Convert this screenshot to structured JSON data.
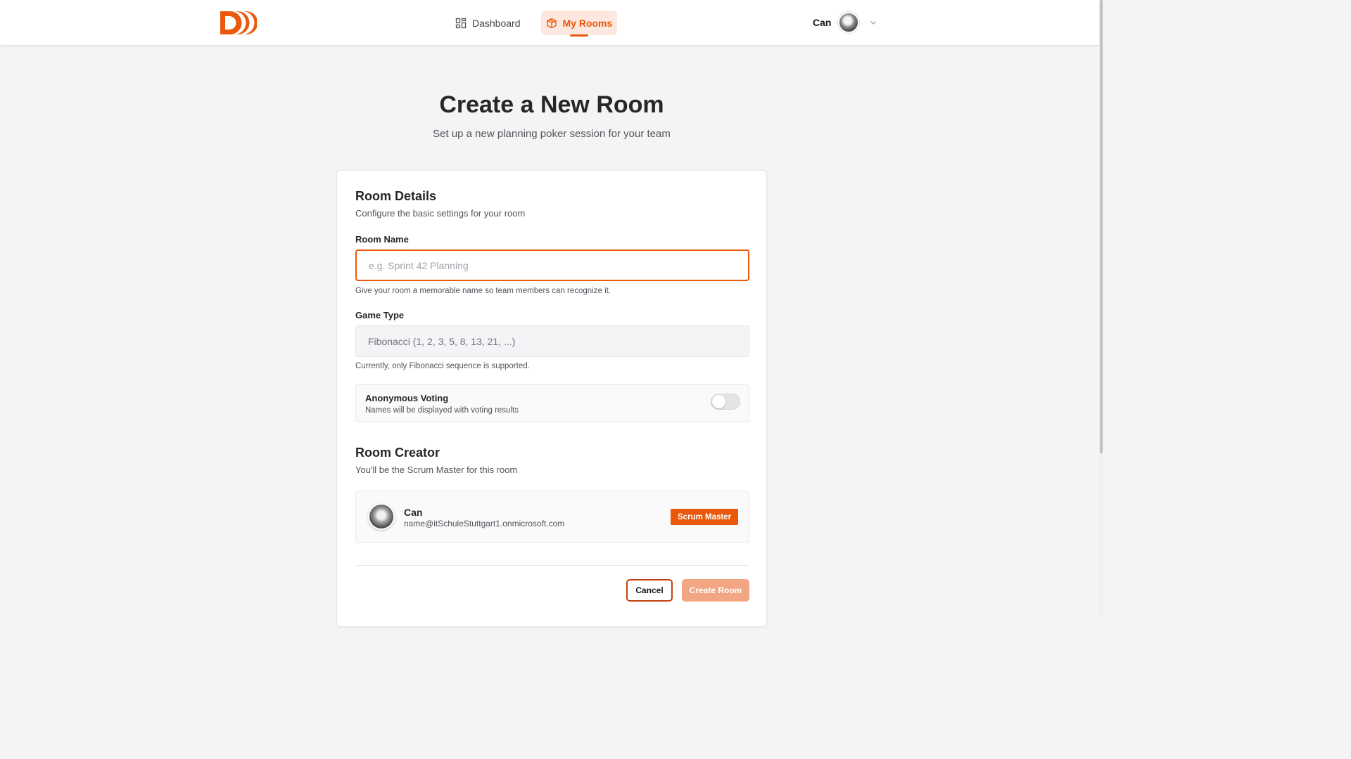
{
  "header": {
    "nav": [
      {
        "label": "Dashboard",
        "icon": "grid-icon"
      },
      {
        "label": "My Rooms",
        "icon": "box-icon",
        "active": true
      }
    ],
    "user": {
      "name": "Can"
    }
  },
  "page": {
    "title": "Create a New Room",
    "subtitle": "Set up a new planning poker session for your team"
  },
  "room_details": {
    "title": "Room Details",
    "description": "Configure the basic settings for your room",
    "room_name": {
      "label": "Room Name",
      "value": "",
      "placeholder": "e.g. Sprint 42 Planning",
      "hint": "Give your room a memorable name so team members can recognize it."
    },
    "game_type": {
      "label": "Game Type",
      "value": "Fibonacci (1, 2, 3, 5, 8, 13, 21, ...)",
      "hint": "Currently, only Fibonacci sequence is supported."
    },
    "anonymous_voting": {
      "title": "Anonymous Voting",
      "description": "Names will be displayed with voting results",
      "enabled": false
    }
  },
  "room_creator": {
    "title": "Room Creator",
    "description": "You'll be the Scrum Master for this room",
    "name": "Can",
    "email": "name@itSchuleStuttgart1.onmicrosoft.com",
    "role_badge": "Scrum Master"
  },
  "actions": {
    "cancel_label": "Cancel",
    "create_label": "Create Room"
  },
  "colors": {
    "accent": "#ea580c",
    "accent_light": "#fde8df",
    "create_disabled": "#f3a683"
  }
}
